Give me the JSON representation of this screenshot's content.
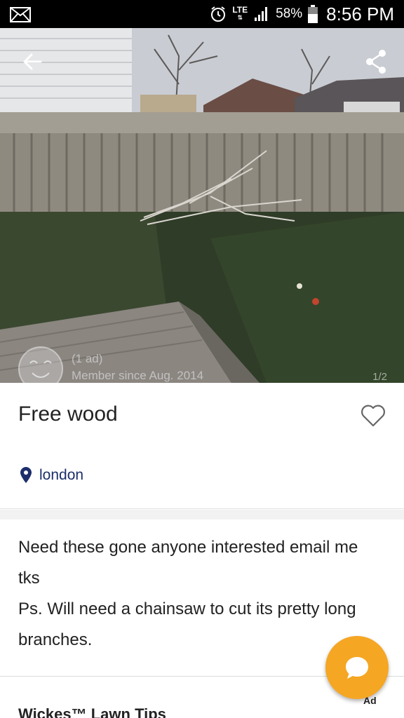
{
  "status_bar": {
    "network": "LTE",
    "battery": "58%",
    "time": "8:56 PM",
    "icons": [
      "mail-icon",
      "alarm-icon",
      "signal-icon",
      "battery-icon"
    ]
  },
  "photo": {
    "pager": "1/2",
    "seller": {
      "ads": "(1 ad)",
      "member_since": "Member since Aug. 2014"
    }
  },
  "listing": {
    "title": "Free wood",
    "location": "london"
  },
  "description": {
    "line1": "Need these gone anyone interested email me",
    "line2": "tks",
    "line3": "Ps. Will need a chainsaw to cut its pretty long",
    "line4": "branches."
  },
  "ad": {
    "label": "Ad",
    "title": "Wickes™ Lawn Tips"
  },
  "colors": {
    "accent": "#f5a623",
    "location": "#1b2f6b"
  }
}
